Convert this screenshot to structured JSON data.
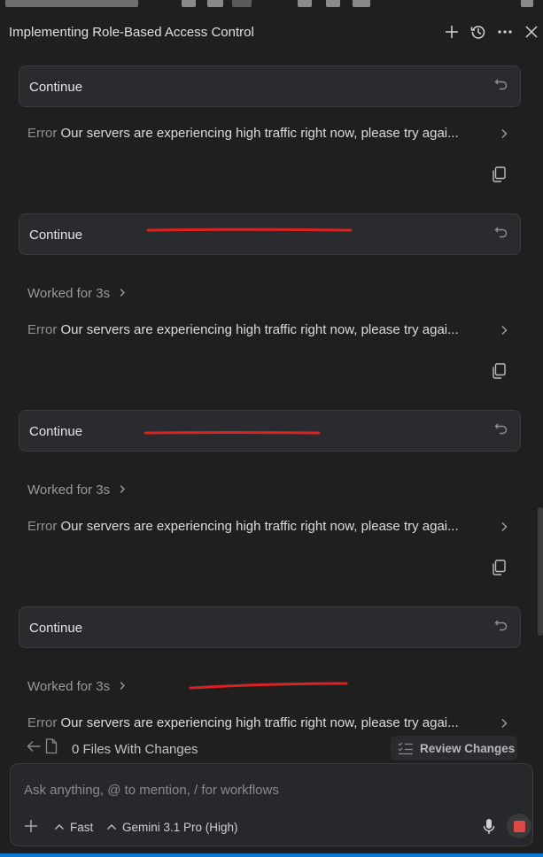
{
  "header": {
    "title": "Implementing Role-Based Access Control"
  },
  "conversation": {
    "user_messages": [
      "Continue",
      "Continue",
      "Continue",
      "Continue"
    ],
    "worked_labels": [
      "Worked for 3s",
      "Worked for 3s",
      "Worked for 3s"
    ],
    "errors": [
      {
        "label": "Error",
        "message": "Our servers are experiencing high traffic right now, please try agai..."
      },
      {
        "label": "Error",
        "message": "Our servers are experiencing high traffic right now, please try agai..."
      },
      {
        "label": "Error",
        "message": "Our servers are experiencing high traffic right now, please try agai..."
      },
      {
        "label": "Error",
        "message": "Our servers are experiencing high traffic right now, please try agai..."
      }
    ]
  },
  "files_bar": {
    "count_label": "0 Files With Changes",
    "review_label": "Review Changes"
  },
  "composer": {
    "placeholder": "Ask anything, @ to mention, / for workflows",
    "mode": "Fast",
    "model": "Gemini 3.1 Pro (High)"
  },
  "colors": {
    "background": "#1f1f1f",
    "card": "#2a2b2e",
    "annotation_red": "#d92323",
    "stop_red": "#e04848",
    "accent_blue": "#0a78d4"
  },
  "icons": [
    "plus-icon",
    "history-icon",
    "more-icon",
    "close-icon",
    "undo-icon",
    "chevron-right-icon",
    "copy-icon",
    "back-arrow-icon",
    "file-icon",
    "review-list-icon",
    "chevron-up-icon",
    "microphone-icon",
    "stop-icon"
  ]
}
